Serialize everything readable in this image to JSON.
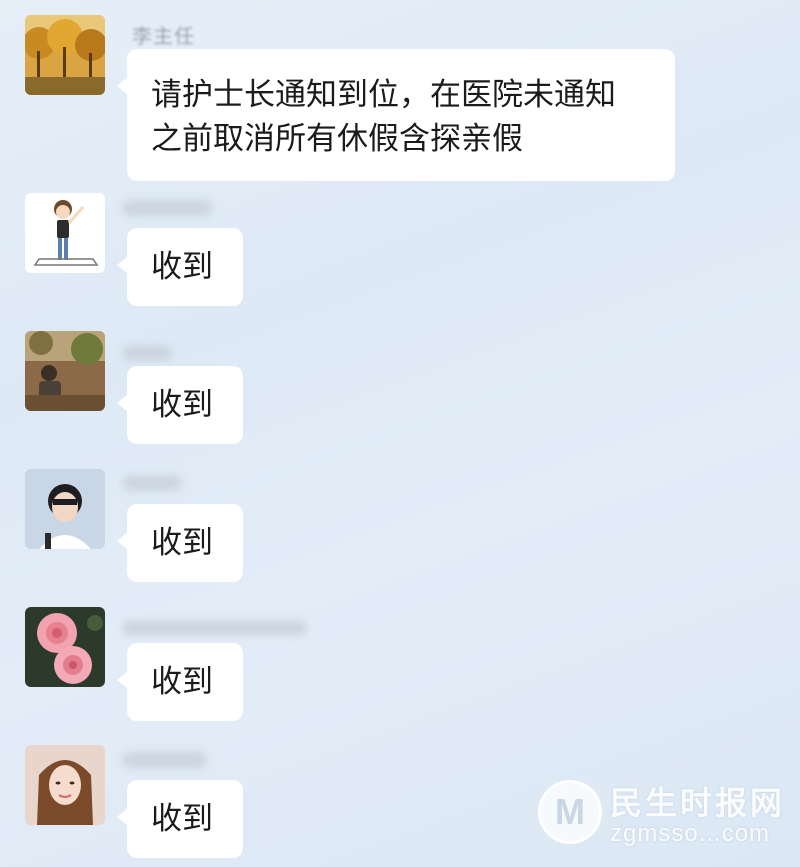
{
  "chat": {
    "messages": [
      {
        "sender": "李主任",
        "lines": [
          "请护士长通知到位，在医院未通知",
          "之前取消所有休假含探亲假"
        ],
        "avatar_icon": "autumn-trees-avatar-icon"
      },
      {
        "text": "收到",
        "avatar_icon": "cartoon-figure-avatar-icon"
      },
      {
        "text": "收到",
        "avatar_icon": "outdoor-photo-avatar-icon"
      },
      {
        "text": "收到",
        "avatar_icon": "young-man-avatar-icon"
      },
      {
        "text": "收到",
        "avatar_icon": "pink-roses-avatar-icon"
      },
      {
        "text": "收到",
        "avatar_icon": "woman-portrait-avatar-icon"
      }
    ]
  },
  "watermark": {
    "title": "民生时报网",
    "subtitle": "zgmsso...com",
    "logo_icon": "m-logo-icon"
  },
  "colors": {
    "background": "#e3edf8",
    "bubble": "#ffffff",
    "text": "#1b1b1b",
    "sender_name": "#9aa3ad"
  }
}
